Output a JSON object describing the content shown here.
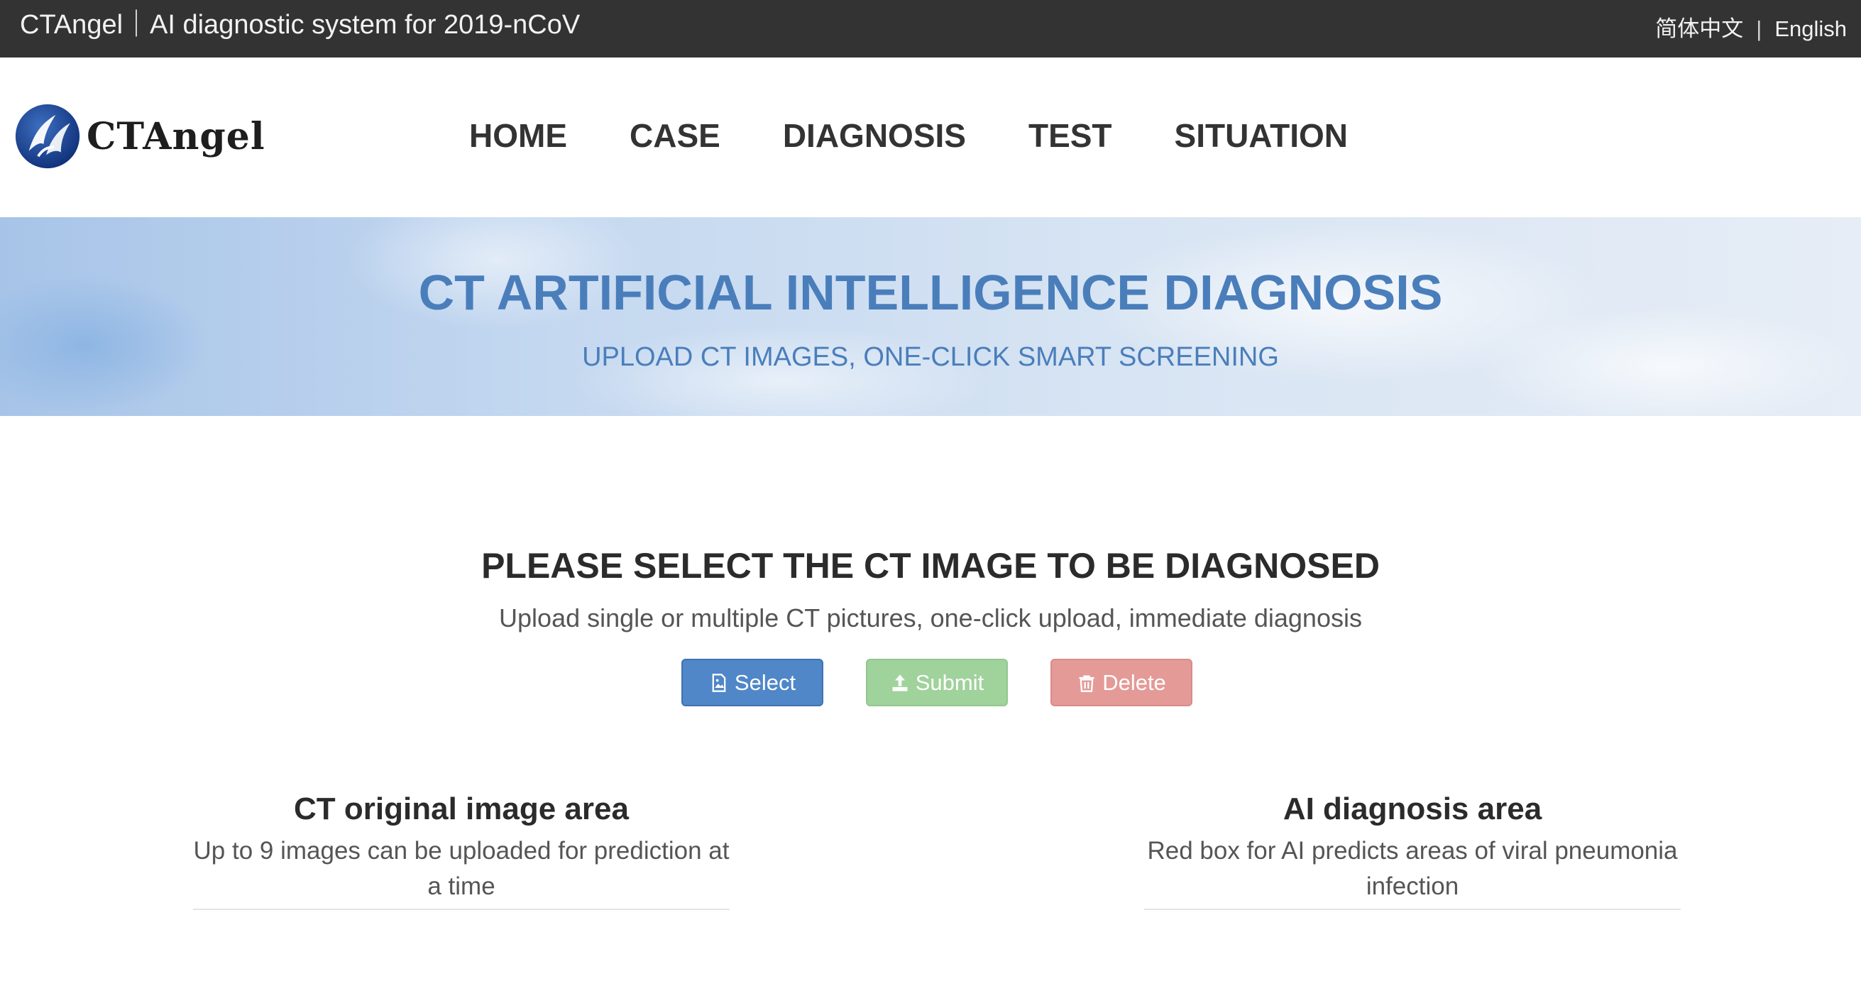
{
  "topbar": {
    "site_title": "CTAngel｜AI diagnostic system for 2019-nCoV",
    "lang_zh": "简体中文",
    "lang_sep": "|",
    "lang_en": "English"
  },
  "header": {
    "logo_text": "CTAngel",
    "nav": [
      "HOME",
      "CASE",
      "DIAGNOSIS",
      "TEST",
      "SITUATION"
    ]
  },
  "banner": {
    "title": "CT ARTIFICIAL INTELLIGENCE DIAGNOSIS",
    "subtitle": "UPLOAD CT IMAGES, ONE-CLICK SMART SCREENING"
  },
  "main": {
    "title": "PLEASE SELECT THE CT IMAGE TO BE DIAGNOSED",
    "description": "Upload single or multiple CT pictures, one-click upload, immediate diagnosis",
    "buttons": {
      "select": "Select",
      "submit": "Submit",
      "delete": "Delete"
    },
    "left_area": {
      "title": "CT original image area",
      "description": "Up to 9 images can be uploaded for prediction at a time"
    },
    "right_area": {
      "title": "AI diagnosis area",
      "description": "Red box for AI predicts areas of viral pneumonia infection"
    }
  },
  "colors": {
    "topbar_bg": "#333333",
    "banner_text": "#4a7ebb",
    "select_btn": "#4f87c8",
    "submit_btn": "#a0d29c",
    "delete_btn": "#e49a97"
  },
  "icons": {
    "logo": "angel-wing-logo-icon",
    "select": "image-file-icon",
    "submit": "upload-icon",
    "delete": "trash-icon"
  }
}
